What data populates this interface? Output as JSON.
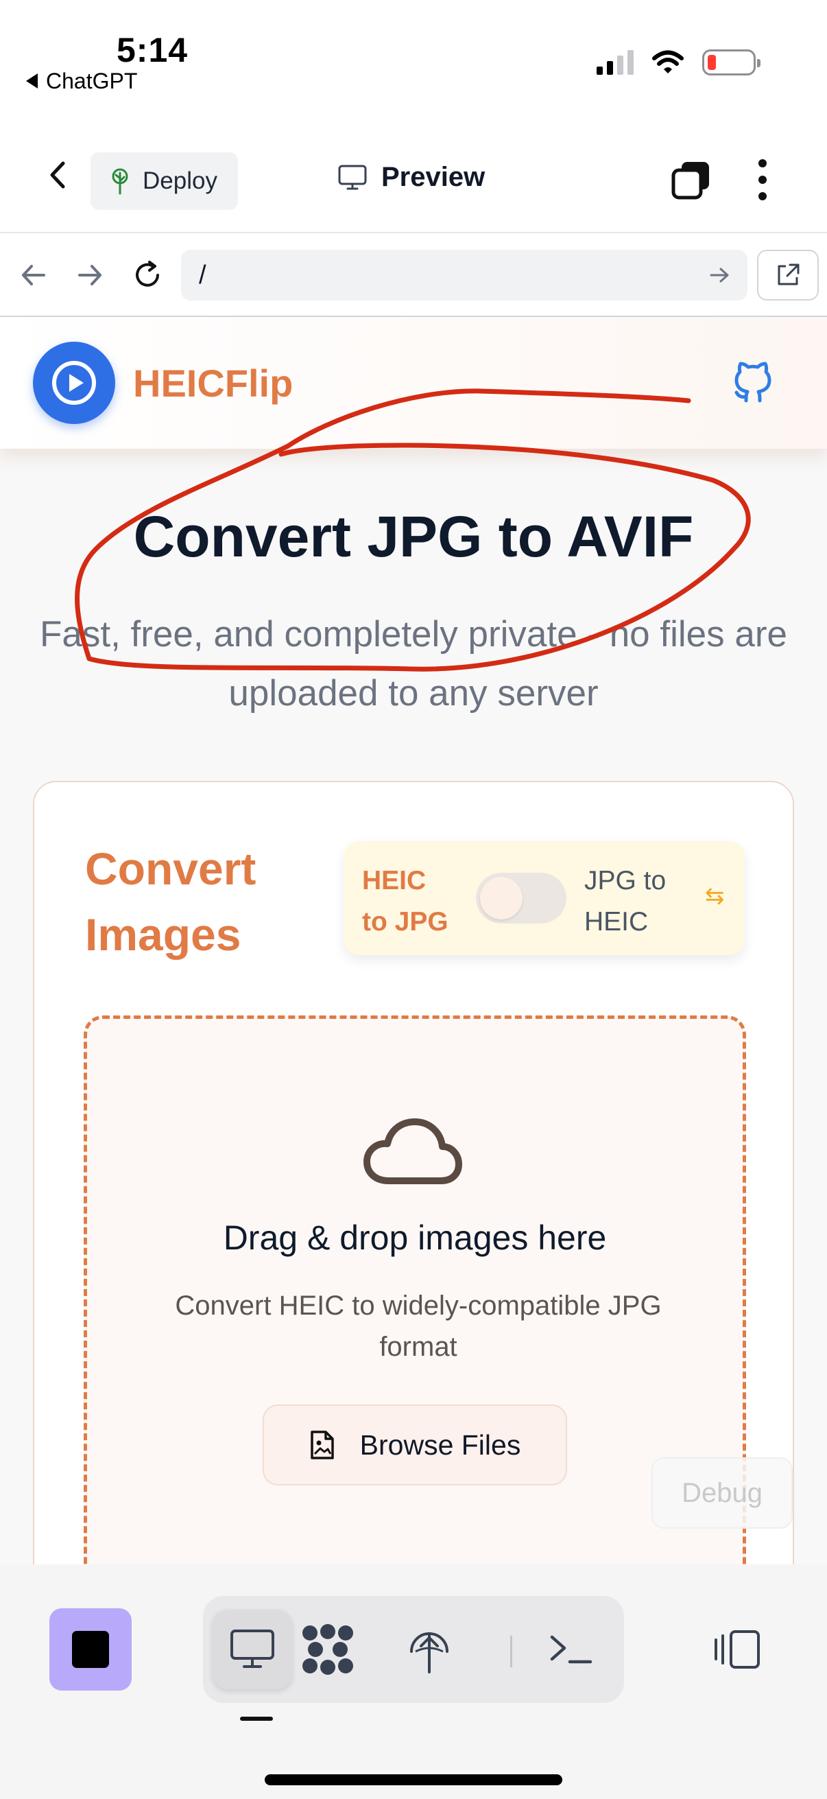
{
  "status_bar": {
    "time": "5:14",
    "back_app": "ChatGPT"
  },
  "toolbar": {
    "deploy_label": "Deploy",
    "preview_label": "Preview"
  },
  "url_bar": {
    "value": "/"
  },
  "site": {
    "brand": "HEICFlip",
    "hero_title": "Convert JPG to AVIF",
    "hero_subtitle": "Fast, free, and completely private - no files are uploaded to any server",
    "card": {
      "title": "Convert Images",
      "toggle": {
        "left_label": "HEIC to JPG",
        "right_label": "JPG to HEIC",
        "swap_icon": "⇆",
        "is_on": false
      },
      "dropzone": {
        "title": "Drag & drop images here",
        "subtitle": "Convert HEIC to widely-compatible JPG format",
        "browse_label": "Browse Files"
      }
    },
    "debug_label": "Debug"
  },
  "bottom_bar": {
    "active_tab": "preview",
    "tabs": [
      "preview",
      "database",
      "deploy",
      "terminal"
    ]
  },
  "colors": {
    "brand_orange": "#e07b45",
    "logo_blue": "#2f6fe6",
    "annotation_red": "#d42b14",
    "stop_purple": "#b8a9fa"
  }
}
